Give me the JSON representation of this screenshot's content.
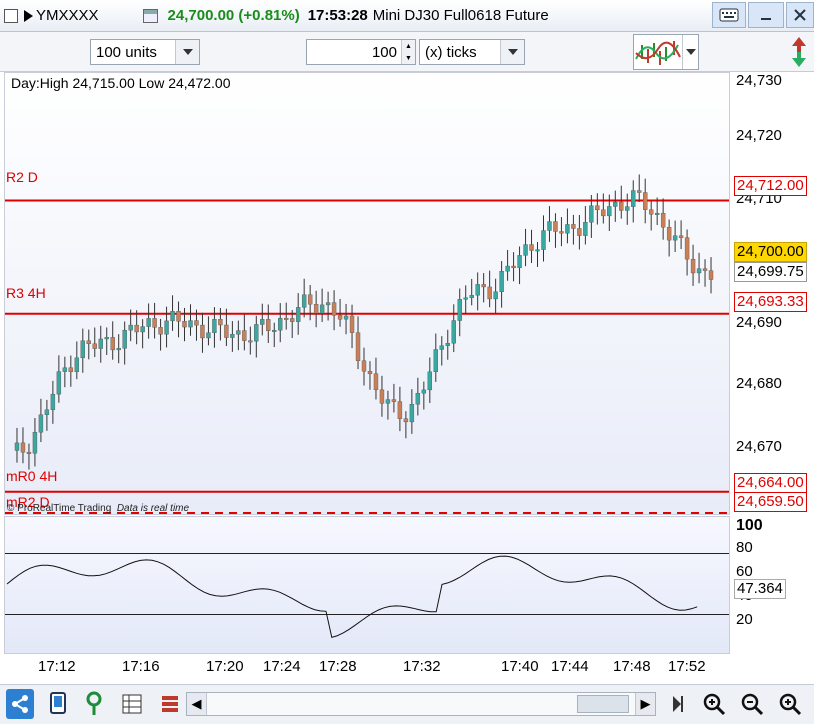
{
  "window": {
    "symbol": "YMXXXX",
    "price_change": "24,700.00 (+0.81%)",
    "time": "17:53:28",
    "instrument": "Mini DJ30 Full0618 Future"
  },
  "toolbar": {
    "units": "100 units",
    "quantity": "100",
    "ticks": "(x) ticks"
  },
  "chart": {
    "day_info": "Day:High 24,715.00 Low 24,472.00",
    "watermark_brand": "© ProRealTime Trading",
    "watermark_status": "Data is real time",
    "lines": [
      {
        "label": "R2 D",
        "value": 24712.0,
        "tag": "24,712.00"
      },
      {
        "label": "R3 4H",
        "value": 24693.33,
        "tag": "24,693.33"
      },
      {
        "label": "mR0 4H",
        "value": 24664.0,
        "tag": "24,664.00"
      },
      {
        "label": "mR2 D",
        "value": 24659.5,
        "tag": "24,659.50"
      }
    ],
    "current_price_tag": "24,700.00",
    "secondary_tag": "24,699.75",
    "y_ticks": [
      "24,730",
      "24,720",
      "24,710",
      "24,690",
      "24,680",
      "24,670"
    ],
    "x_ticks": [
      "17:12",
      "17:16",
      "17:20",
      "17:24",
      "17:28",
      "17:32",
      "17:40",
      "17:44",
      "17:48",
      "17:52"
    ],
    "colors": {
      "up": "#3aa8a0",
      "down": "#c98058",
      "level": "#e00000",
      "current": "#ffd700"
    }
  },
  "indicator": {
    "y_ticks": [
      "100",
      "80",
      "60",
      "40",
      "20"
    ],
    "value_tag": "47.364",
    "line_levels": [
      75,
      25
    ]
  },
  "chart_data": {
    "type": "line",
    "title": "",
    "xlabel": "",
    "ylabel": "",
    "x": [
      "17:12",
      "17:16",
      "17:20",
      "17:24",
      "17:28",
      "17:32",
      "17:40",
      "17:44",
      "17:48",
      "17:52"
    ],
    "ylim": [
      24660,
      24733
    ],
    "series": [
      {
        "values": [
          24670,
          24688,
          24692,
          24690,
          24695,
          24677,
          24697,
          24707,
          24712,
          24700
        ]
      }
    ],
    "levels": [
      24712.0,
      24693.33,
      24664.0,
      24659.5
    ],
    "oscillator": {
      "ylim": [
        0,
        100
      ],
      "last": 47.364
    }
  }
}
